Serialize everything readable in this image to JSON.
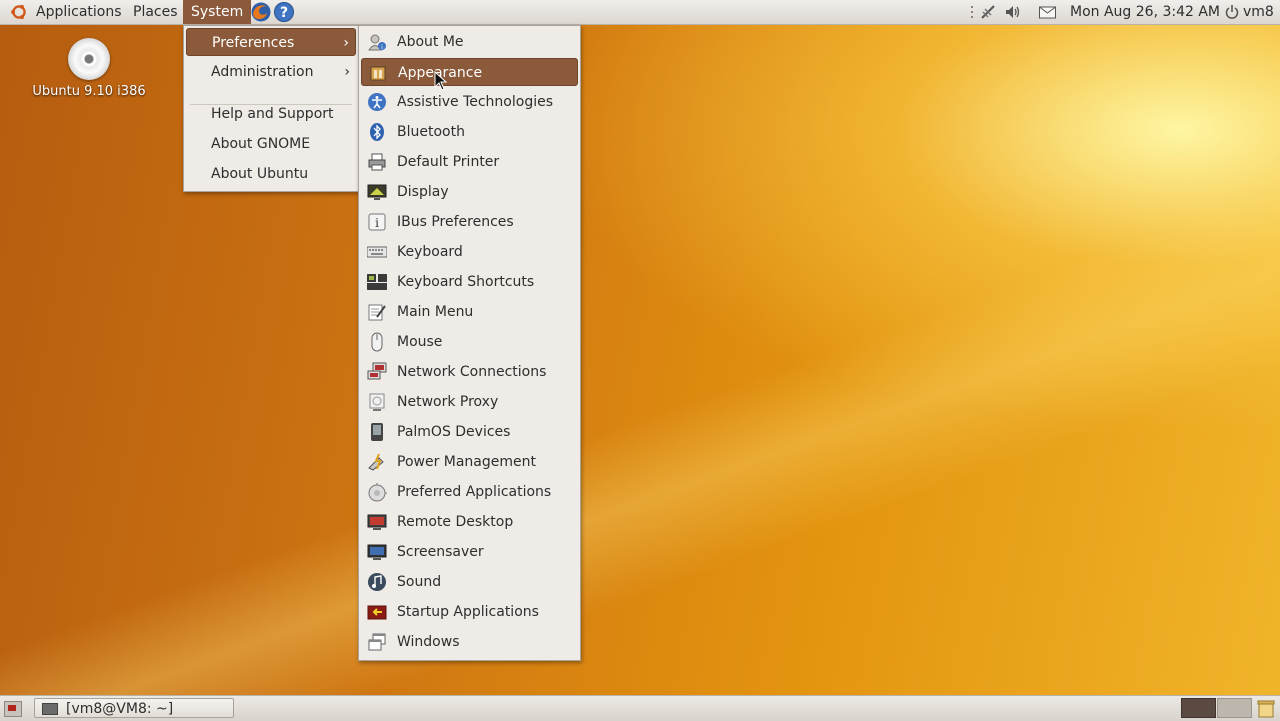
{
  "top_panel": {
    "menus": {
      "applications": "Applications",
      "places": "Places",
      "system": "System"
    },
    "launchers": [
      "firefox-icon",
      "help-icon"
    ],
    "tray": {
      "datetime": "Mon Aug 26,  3:42 AM",
      "user": "vm8",
      "icons": [
        "network-icon",
        "volume-icon",
        "mail-icon",
        "power-icon"
      ]
    }
  },
  "desktop": {
    "icons": [
      {
        "label": "Ubuntu 9.10 i386",
        "icon": "cd-icon"
      }
    ]
  },
  "system_menu": {
    "items": [
      {
        "label": "Preferences",
        "submenu": true,
        "active": true
      },
      {
        "label": "Administration",
        "submenu": true
      },
      {
        "label": "Help and Support"
      },
      {
        "label": "About GNOME"
      },
      {
        "label": "About Ubuntu"
      }
    ]
  },
  "preferences_menu": {
    "items": [
      {
        "label": "About Me",
        "icon": "about-me-icon"
      },
      {
        "label": "Appearance",
        "icon": "appearance-icon",
        "active": true
      },
      {
        "label": "Assistive Technologies",
        "icon": "accessibility-icon"
      },
      {
        "label": "Bluetooth",
        "icon": "bluetooth-icon"
      },
      {
        "label": "Default Printer",
        "icon": "printer-icon"
      },
      {
        "label": "Display",
        "icon": "display-icon"
      },
      {
        "label": "IBus Preferences",
        "icon": "ibus-icon"
      },
      {
        "label": "Keyboard",
        "icon": "keyboard-icon"
      },
      {
        "label": "Keyboard Shortcuts",
        "icon": "keyboard-shortcuts-icon"
      },
      {
        "label": "Main Menu",
        "icon": "main-menu-icon"
      },
      {
        "label": "Mouse",
        "icon": "mouse-icon"
      },
      {
        "label": "Network Connections",
        "icon": "network-connections-icon"
      },
      {
        "label": "Network Proxy",
        "icon": "network-proxy-icon"
      },
      {
        "label": "PalmOS Devices",
        "icon": "palmos-icon"
      },
      {
        "label": "Power Management",
        "icon": "power-management-icon"
      },
      {
        "label": "Preferred Applications",
        "icon": "preferred-apps-icon"
      },
      {
        "label": "Remote Desktop",
        "icon": "remote-desktop-icon"
      },
      {
        "label": "Screensaver",
        "icon": "screensaver-icon"
      },
      {
        "label": "Sound",
        "icon": "sound-icon"
      },
      {
        "label": "Startup Applications",
        "icon": "startup-icon"
      },
      {
        "label": "Windows",
        "icon": "windows-icon"
      }
    ]
  },
  "bottom_panel": {
    "taskbar": [
      {
        "label": "[vm8@VM8: ~]",
        "icon": "terminal-icon"
      }
    ],
    "workspaces": 2
  },
  "colors": {
    "highlight": "#8a5a3a",
    "menu_bg": "#efebe7",
    "panel_bg": "#dcd7d0"
  }
}
